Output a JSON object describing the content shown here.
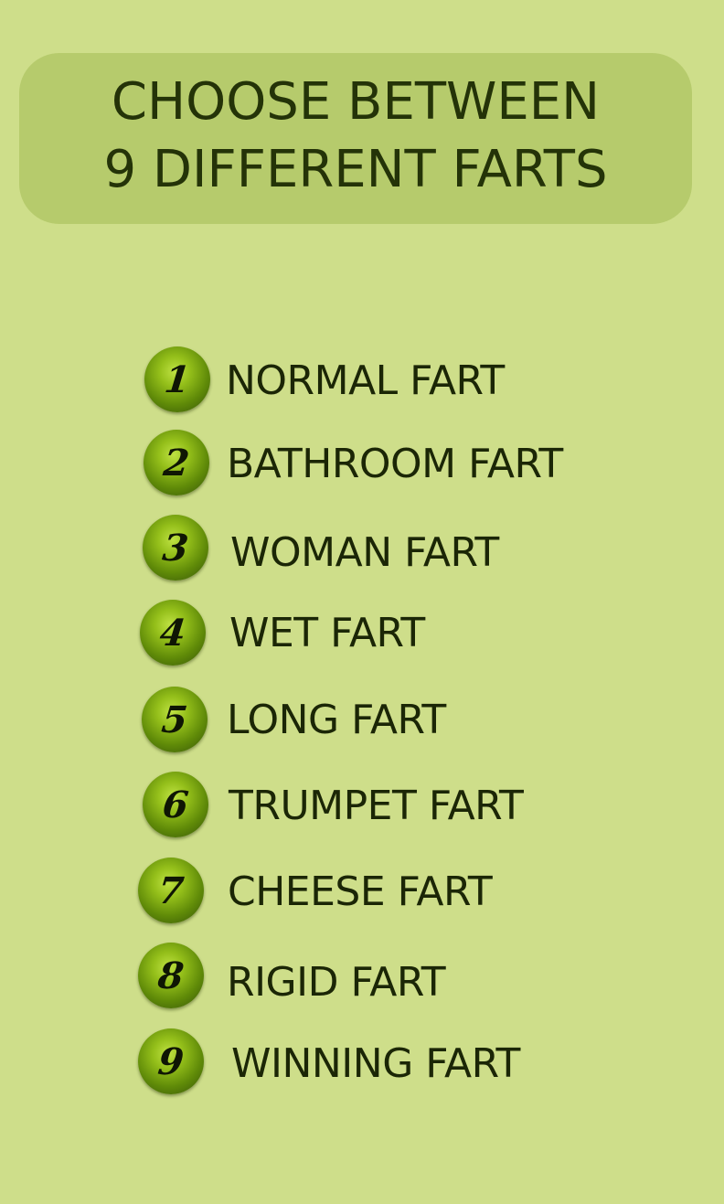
{
  "header": {
    "line1": "CHOOSE BETWEEN",
    "line2": "9 DIFFERENT FARTS"
  },
  "farts": [
    {
      "number": "1",
      "label": "NORMAL FART"
    },
    {
      "number": "2",
      "label": "BATHROOM FART"
    },
    {
      "number": "3",
      "label": "WOMAN FART"
    },
    {
      "number": "4",
      "label": "WET FART"
    },
    {
      "number": "5",
      "label": "LONG FART"
    },
    {
      "number": "6",
      "label": "TRUMPET FART"
    },
    {
      "number": "7",
      "label": "CHEESE FART"
    },
    {
      "number": "8",
      "label": "RIGID FART"
    },
    {
      "number": "9",
      "label": "WINNING FART"
    }
  ],
  "colors": {
    "background": "#cede8a",
    "header_background": "#b6cb6c",
    "text": "#1b2606",
    "badge": "#6f9a0c"
  }
}
